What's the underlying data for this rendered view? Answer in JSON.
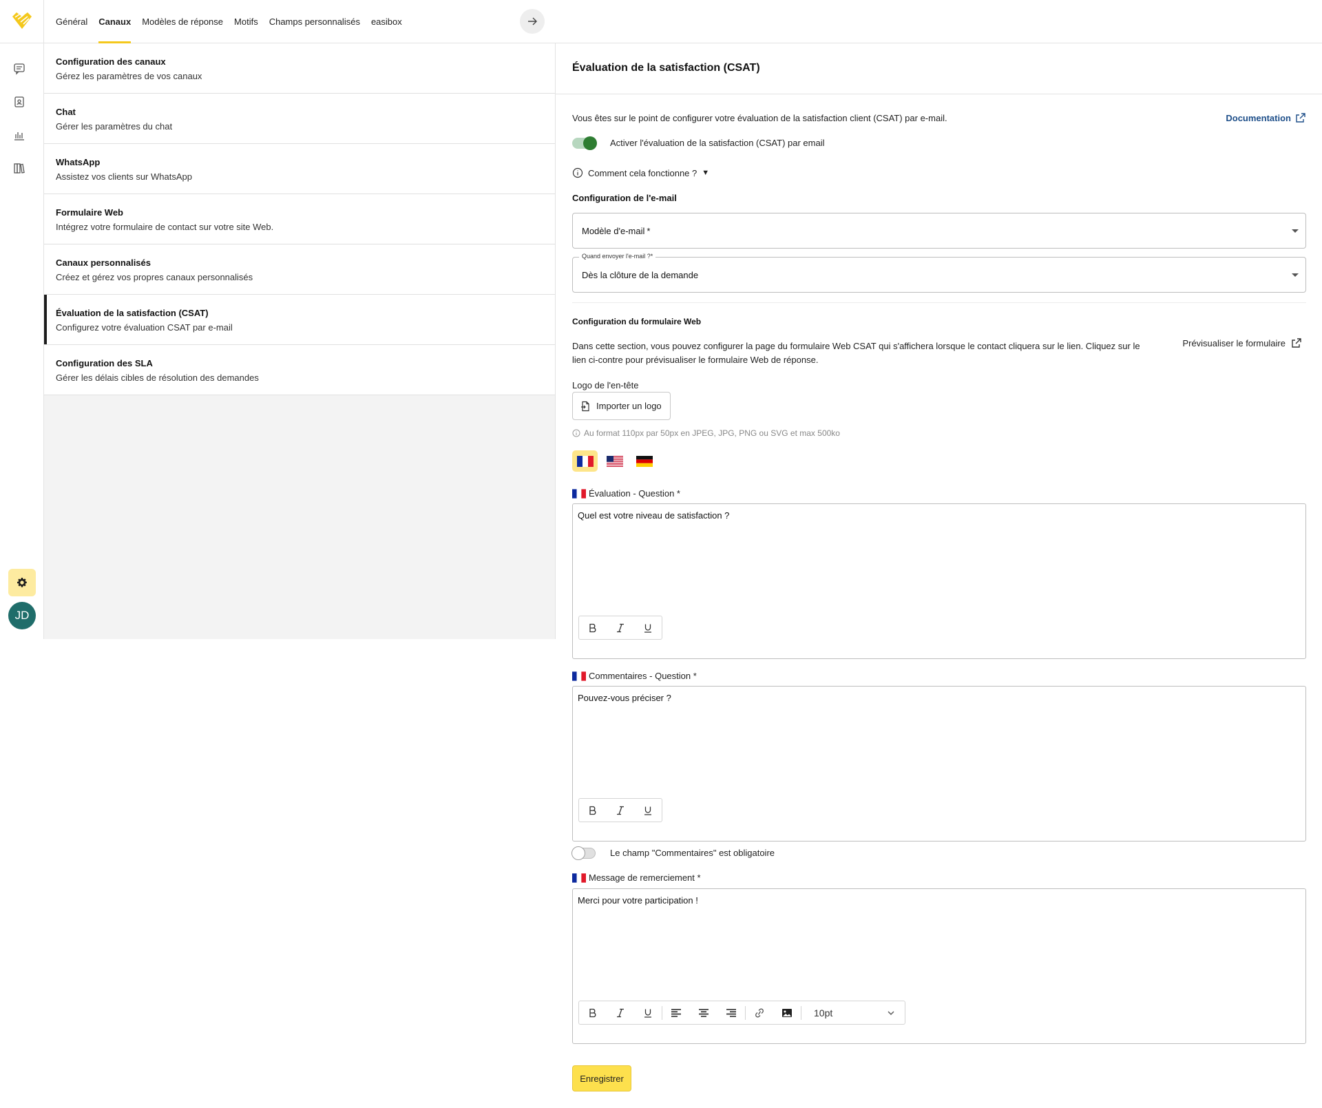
{
  "tabs": [
    {
      "label": "Général"
    },
    {
      "label": "Canaux"
    },
    {
      "label": "Modèles de réponse"
    },
    {
      "label": "Motifs"
    },
    {
      "label": "Champs personnalisés"
    },
    {
      "label": "easibox"
    }
  ],
  "active_tab": "Canaux",
  "user": {
    "initials": "JD"
  },
  "channels": [
    {
      "title": "Configuration des canaux",
      "subtitle": "Gérez les paramètres de vos canaux"
    },
    {
      "title": "Chat",
      "subtitle": "Gérer les paramètres du chat"
    },
    {
      "title": "WhatsApp",
      "subtitle": "Assistez vos clients sur WhatsApp"
    },
    {
      "title": "Formulaire Web",
      "subtitle": "Intégrez votre formulaire de contact sur votre site Web."
    },
    {
      "title": "Canaux personnalisés",
      "subtitle": "Créez et gérez vos propres canaux personnalisés"
    },
    {
      "title": "Évaluation de la satisfaction (CSAT)",
      "subtitle": "Configurez votre évaluation CSAT par e-mail"
    },
    {
      "title": "Configuration des SLA",
      "subtitle": "Gérer les délais cibles de résolution des demandes"
    }
  ],
  "panel": {
    "title": "Évaluation de la satisfaction (CSAT)",
    "intro": "Vous êtes sur le point de configurer votre évaluation de la satisfaction client (CSAT) par e-mail.",
    "doc_link": "Documentation",
    "enable_toggle": {
      "label": "Activer l'évaluation de la satisfaction (CSAT) par email",
      "on": true
    },
    "how_it_works": "Comment cela fonctionne ?",
    "email_config": {
      "title": "Configuration de l'e-mail",
      "template_label": "Modèle d'e-mail",
      "required_mark": "*",
      "when_label": "Quand envoyer l'e-mail ?",
      "when_value": "Dès la clôture de la demande"
    },
    "web_form": {
      "title": "Configuration du formulaire Web",
      "description": "Dans cette section, vous pouvez configurer la page du formulaire Web CSAT qui s'affichera lorsque le contact cliquera sur le lien. Cliquez sur le lien ci-contre pour prévisualiser le formulaire Web de réponse.",
      "preview_link": "Prévisualiser le formulaire",
      "logo_label": "Logo de l'en-tête",
      "import_button": "Importer un logo",
      "logo_hint": "Au format 110px par 50px en JPEG, JPG, PNG ou SVG et max 500ko"
    },
    "languages": [
      "fr",
      "en",
      "de"
    ],
    "active_language": "fr",
    "rating_question": {
      "label": "Évaluation - Question *",
      "value": "Quel est votre niveau de satisfaction ?"
    },
    "comment_question": {
      "label": "Commentaires - Question *",
      "value": "Pouvez-vous préciser ?"
    },
    "comment_required_toggle": {
      "label": "Le champ \"Commentaires\" est obligatoire",
      "on": false
    },
    "thanks_message": {
      "label": "Message de remerciement *",
      "value": "Merci pour votre participation !"
    },
    "font_size": "10pt",
    "save_button": "Enregistrer"
  },
  "colors": {
    "accent": "#f4c81c",
    "toggle_on": "#2e7d32",
    "link": "#1d4e89",
    "avatar": "#1f6d6a",
    "save": "#fde04d"
  }
}
